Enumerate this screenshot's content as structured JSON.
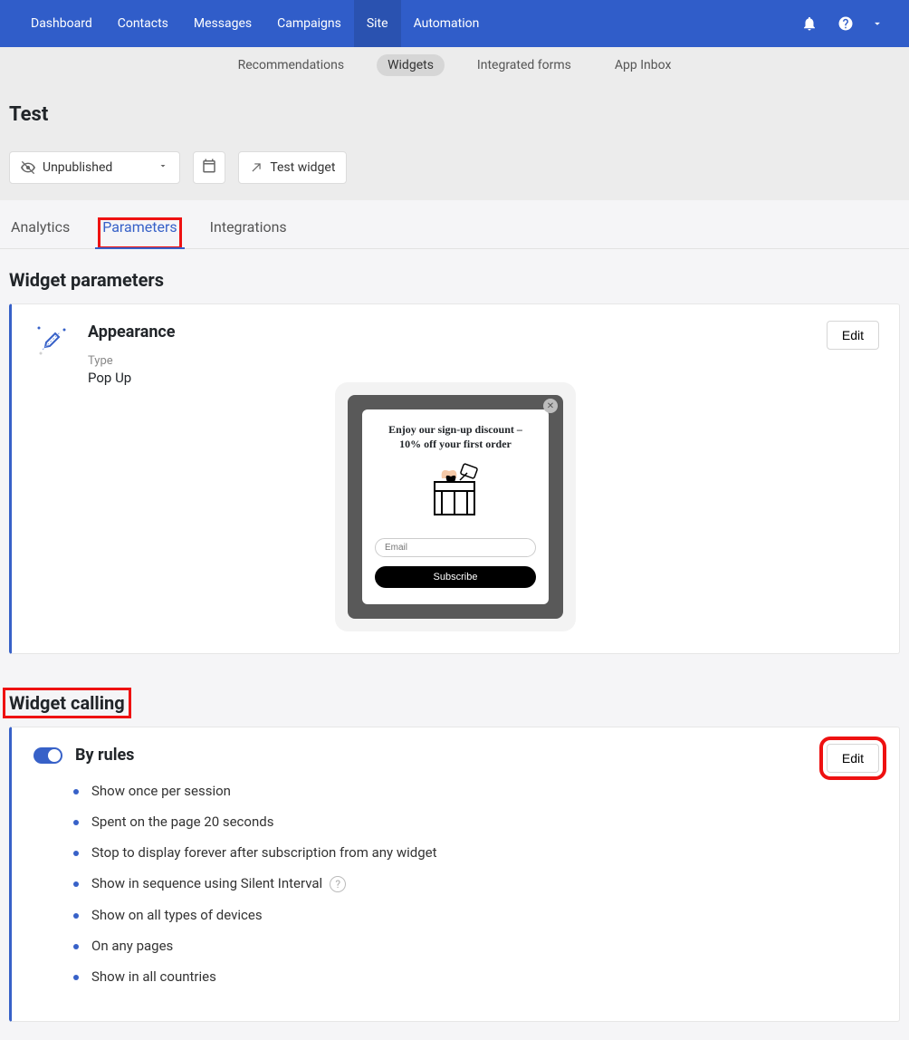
{
  "topnav": {
    "items": [
      "Dashboard",
      "Contacts",
      "Messages",
      "Campaigns",
      "Site",
      "Automation"
    ],
    "active_index": 4
  },
  "subnav": {
    "items": [
      "Recommendations",
      "Widgets",
      "Integrated forms",
      "App Inbox"
    ],
    "active_index": 1
  },
  "page": {
    "title": "Test"
  },
  "toolbar": {
    "status": "Unpublished",
    "test_widget": "Test widget"
  },
  "tabs": {
    "items": [
      "Analytics",
      "Parameters",
      "Integrations"
    ],
    "active_index": 1
  },
  "sections": {
    "widget_parameters_title": "Widget parameters",
    "widget_calling_title": "Widget calling"
  },
  "appearance": {
    "title": "Appearance",
    "type_label": "Type",
    "type_value": "Pop Up",
    "edit": "Edit",
    "preview": {
      "headline1": "Enjoy our sign-up discount –",
      "headline2": "10% off your first order",
      "email_placeholder": "Email",
      "subscribe": "Subscribe"
    }
  },
  "calling": {
    "title": "By rules",
    "edit": "Edit",
    "rules": [
      "Show once per session",
      "Spent on the page 20 seconds",
      "Stop to display forever after subscription from any widget",
      "Show in sequence using Silent Interval",
      "Show on all types of devices",
      "On any pages",
      "Show in all countries"
    ],
    "help_index": 3
  }
}
